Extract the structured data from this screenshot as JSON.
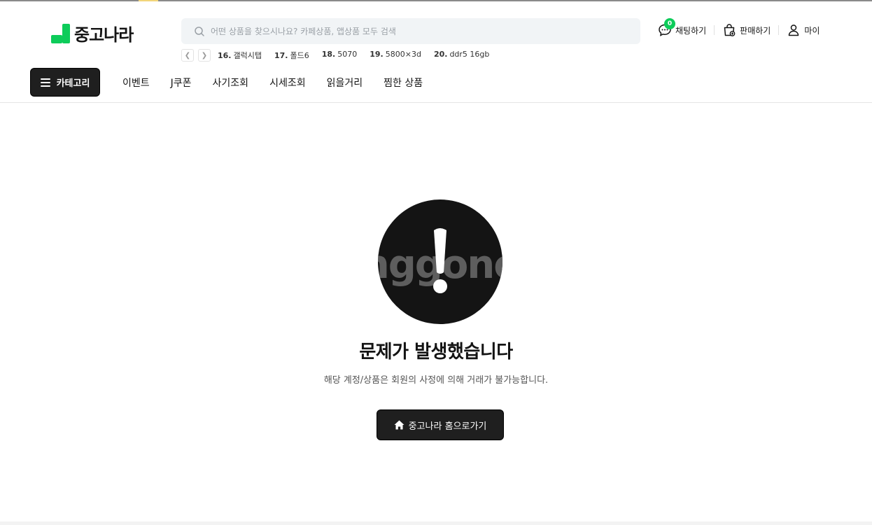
{
  "header": {
    "logo_text": "중고나라",
    "search": {
      "placeholder": "어떤 상품을 찾으시나요? 카페상품, 앱상품 모두 검색",
      "value": ""
    },
    "popular_searches": [
      {
        "rank": "16.",
        "term": "갤럭시탭"
      },
      {
        "rank": "17.",
        "term": "폴드6"
      },
      {
        "rank": "18.",
        "term": "5070"
      },
      {
        "rank": "19.",
        "term": "5800×3d"
      },
      {
        "rank": "20.",
        "term": "ddr5 16gb"
      }
    ],
    "actions": {
      "chat_label": "채팅하기",
      "chat_count": "0",
      "sell_label": "판매하기",
      "my_label": "마이"
    }
  },
  "nav": {
    "category_label": "카테고리",
    "links": [
      "이벤트",
      "J쿠폰",
      "사기조회",
      "시세조회",
      "읽을거리",
      "찜한 상품"
    ]
  },
  "error": {
    "title": "문제가 발생했습니다",
    "message": "해당 계정/상품은 회원의 사정에 의해 거래가 불가능합니다.",
    "home_button_label": "중고나라 홈으로가기",
    "watermark_text": "nggone"
  },
  "colors": {
    "brand_green": "#0dcc5a",
    "dark": "#1f1f1f",
    "search_bg": "#f1f4f6"
  }
}
